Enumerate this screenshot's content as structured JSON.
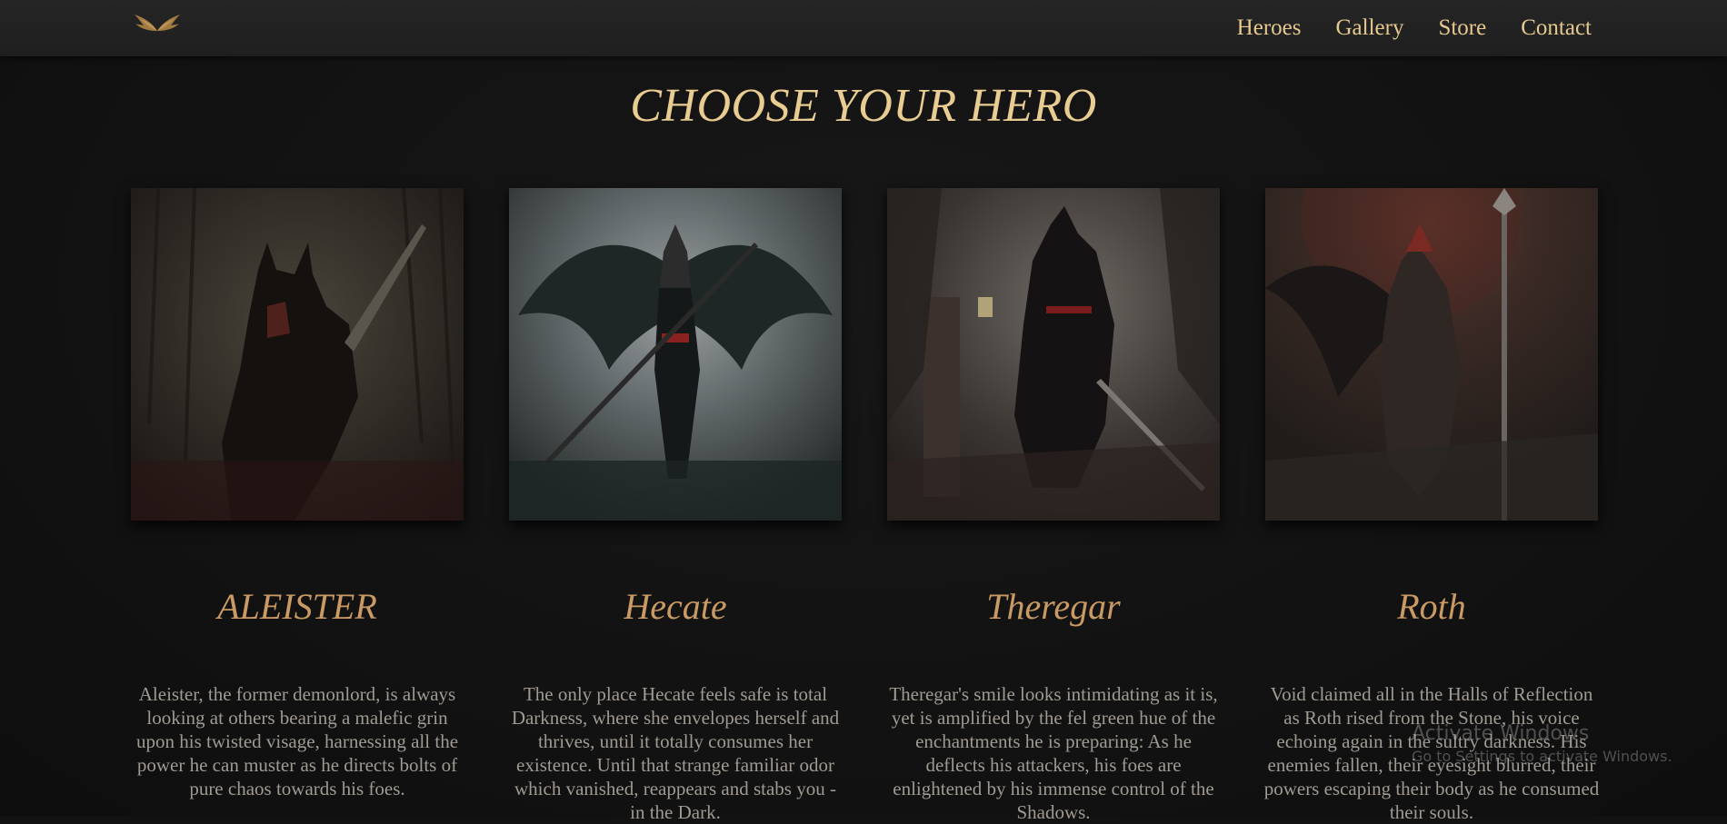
{
  "nav": {
    "logo_icon": "wings-logo-icon",
    "links": [
      "Heroes",
      "Gallery",
      "Store",
      "Contact"
    ]
  },
  "page": {
    "title": "CHOOSE YOUR HERO"
  },
  "heroes": [
    {
      "name": "ALEISTER",
      "description": "Aleister, the former demonlord, is always looking at others bearing a malefic grin upon his twisted visage, harnessing all the power he can muster as he directs bolts of pure chaos towards his foes."
    },
    {
      "name": "Hecate",
      "description": "The only place Hecate feels safe is total Darkness, where she envelopes herself and thrives, until it totally consumes her existence. Until that strange familiar odor which vanished, reappears and stabs you - in the Dark."
    },
    {
      "name": "Theregar",
      "description": "Theregar's smile looks intimidating as it is, yet is amplified by the fel green hue of the enchantments he is preparing: As he deflects his attackers, his foes are enlightened by his immense control of the Shadows."
    },
    {
      "name": "Roth",
      "description": "Void claimed all in the Halls of Reflection as Roth rised from the Stone, his voice echoing again in the sultry darkness. His enemies fallen, their eyesight blurred, their powers escaping their body as he consumed their souls."
    }
  ],
  "watermark": {
    "title": "Activate Windows",
    "subtitle": "Go to Settings to activate Windows."
  },
  "colors": {
    "accent_gold": "#e6c98f",
    "hero_name": "#c99a63",
    "body_text": "#a09a92",
    "background": "#121212"
  }
}
